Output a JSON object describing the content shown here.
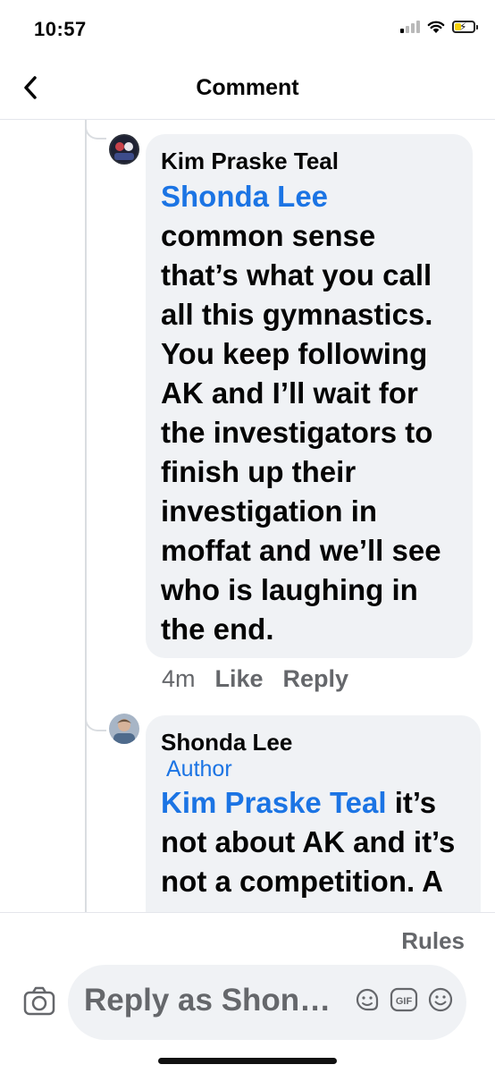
{
  "status_bar": {
    "time": "10:57",
    "signal_bars_active": 1,
    "battery_charging": true,
    "battery_level": 0.35,
    "icons": [
      "signal-icon",
      "wifi-icon",
      "battery-charging-icon"
    ]
  },
  "header": {
    "title": "Comment",
    "back_icon": "chevron-left-icon"
  },
  "comments": [
    {
      "author": "Kim Praske Teal",
      "badge": "",
      "mention": "Shonda Lee",
      "text": "common sense that’s what you call all this gymnastics. You keep following AK and I’ll wait for the investigators to finish up their investigation in moffat and we’ll see who is laughing in the end.",
      "time": "4m",
      "like_label": "Like",
      "reply_label": "Reply"
    },
    {
      "author": "Shonda Lee",
      "badge": "Author",
      "mention": "Kim Praske Teal",
      "text": " it’s not about AK and it’s not a competition. A",
      "time": "",
      "like_label": "",
      "reply_label": ""
    }
  ],
  "composer": {
    "rules_label": "Rules",
    "placeholder": "Reply as Shonda Lee",
    "camera_icon": "camera-icon",
    "sticker_icon": "sticker-icon",
    "gif_icon": "gif-icon",
    "emoji_icon": "emoji-icon",
    "gif_label": "GIF"
  },
  "colors": {
    "link_blue": "#1b74e4",
    "bubble_bg": "#f0f2f5",
    "secondary_text": "#65676b",
    "thread_line": "#dadde1"
  }
}
